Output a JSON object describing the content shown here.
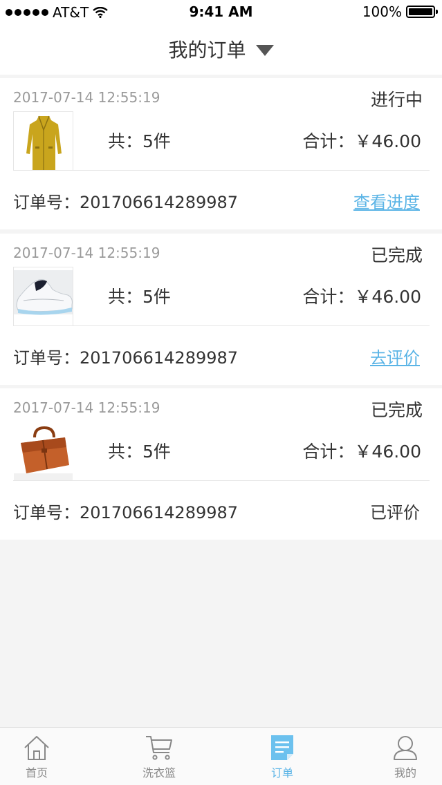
{
  "status_bar": {
    "carrier": "AT&T",
    "time": "9:41 AM",
    "battery": "100%"
  },
  "header": {
    "title": "我的订单"
  },
  "orders": [
    {
      "time": "2017-07-14 12:55:19",
      "status": "进行中",
      "product": "yellow-coat",
      "count": "共：5件",
      "total": "合计：￥46.00",
      "order_no": "订单号：201706614289987",
      "action": "查看进度",
      "action_link": true
    },
    {
      "time": "2017-07-14 12:55:19",
      "status": "已完成",
      "product": "white-sneaker",
      "count": "共：5件",
      "total": "合计：￥46.00",
      "order_no": "订单号：201706614289987",
      "action": "去评价",
      "action_link": true
    },
    {
      "time": "2017-07-14 12:55:19",
      "status": "已完成",
      "product": "brown-bag",
      "count": "共：5件",
      "total": "合计：￥46.00",
      "order_no": "订单号：201706614289987",
      "action": "已评价",
      "action_link": false
    }
  ],
  "tabs": [
    {
      "label": "首页",
      "icon": "home-icon",
      "active": false
    },
    {
      "label": "洗衣篮",
      "icon": "cart-icon",
      "active": false
    },
    {
      "label": "订单",
      "icon": "order-icon",
      "active": true
    },
    {
      "label": "我的",
      "icon": "profile-icon",
      "active": false
    }
  ],
  "colors": {
    "accent": "#5ab4e6",
    "background": "#f4f4f4",
    "muted_text": "#9a9a9a"
  }
}
